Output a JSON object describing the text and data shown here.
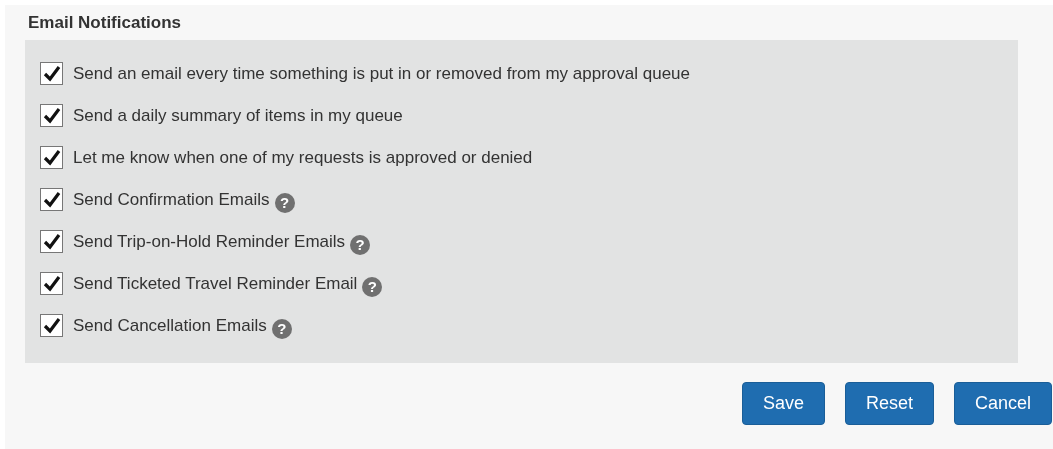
{
  "section_title": "Email Notifications",
  "options": [
    {
      "label": "Send an email every time something is put in or removed from my approval queue",
      "checked": true
    },
    {
      "label": "Send a daily summary of items in my queue",
      "checked": true
    },
    {
      "label": "Let me know when one of my requests is approved or denied",
      "checked": true
    },
    {
      "label": "Send Confirmation Emails",
      "checked": true,
      "help": "?"
    },
    {
      "label": "Send Trip-on-Hold Reminder Emails",
      "checked": true,
      "help": "?"
    },
    {
      "label": "Send Ticketed Travel Reminder Email",
      "checked": true,
      "help": "?"
    },
    {
      "label": "Send Cancellation Emails",
      "checked": true,
      "help": "?"
    }
  ],
  "buttons": [
    "Save",
    "Reset",
    "Cancel"
  ]
}
